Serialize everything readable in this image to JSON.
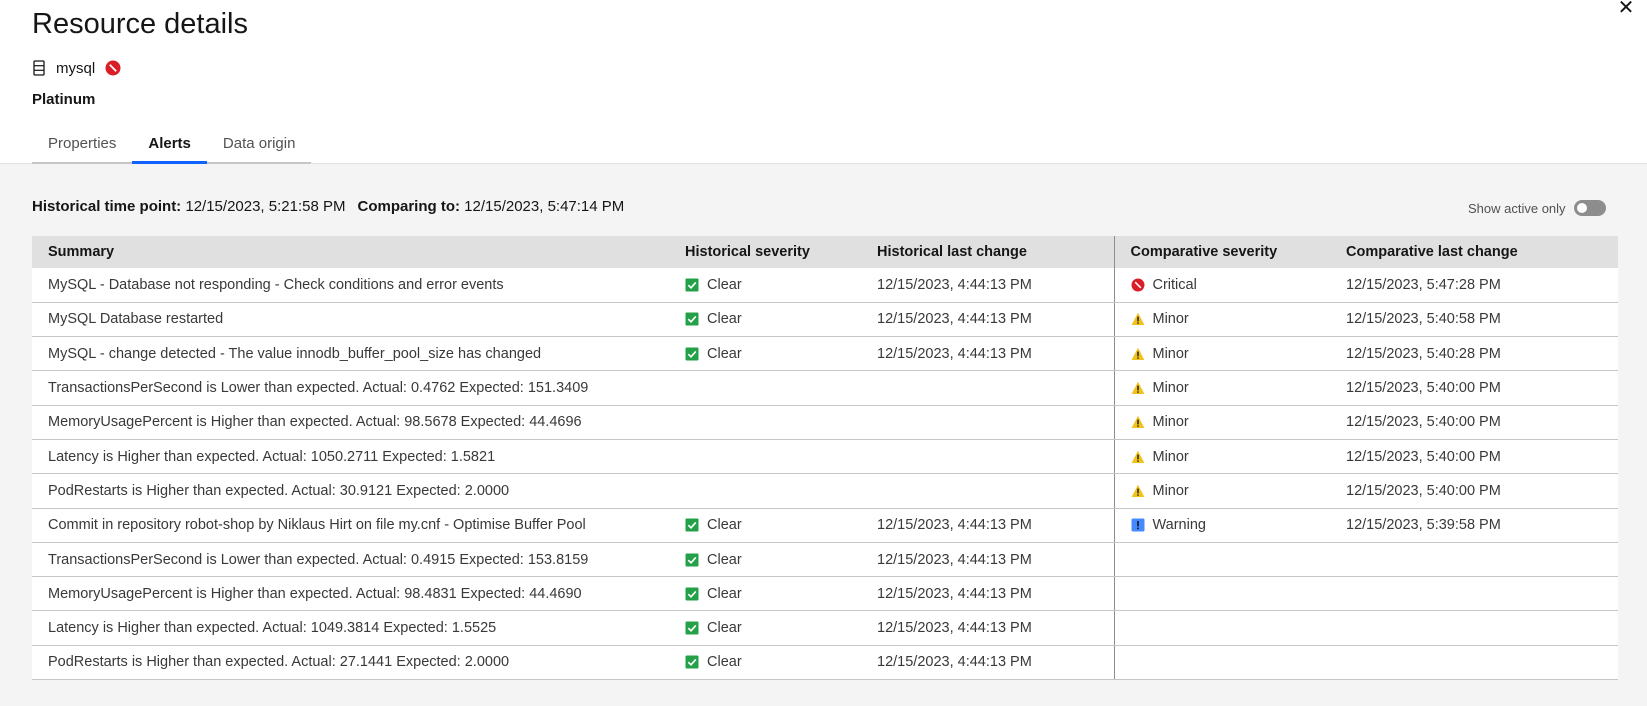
{
  "header": {
    "title": "Resource details",
    "resource_name": "mysql",
    "tier": "Platinum"
  },
  "tabs": [
    {
      "label": "Properties",
      "active": false
    },
    {
      "label": "Alerts",
      "active": true
    },
    {
      "label": "Data origin",
      "active": false
    }
  ],
  "timepoints": {
    "historical_label": "Historical time point:",
    "historical_value": "12/15/2023, 5:21:58 PM",
    "comparing_label": "Comparing to:",
    "comparing_value": "12/15/2023, 5:47:14 PM"
  },
  "toggle": {
    "label": "Show active only",
    "on": false
  },
  "table": {
    "columns": [
      "Summary",
      "Historical severity",
      "Historical last change",
      "Comparative severity",
      "Comparative last change"
    ],
    "rows": [
      {
        "summary": "MySQL - Database not responding - Check conditions and error events",
        "hist_sev": "Clear",
        "hist_change": "12/15/2023, 4:44:13 PM",
        "comp_sev": "Critical",
        "comp_change": "12/15/2023, 5:47:28 PM"
      },
      {
        "summary": "MySQL Database restarted",
        "hist_sev": "Clear",
        "hist_change": "12/15/2023, 4:44:13 PM",
        "comp_sev": "Minor",
        "comp_change": "12/15/2023, 5:40:58 PM"
      },
      {
        "summary": "MySQL - change detected - The value innodb_buffer_pool_size has changed",
        "hist_sev": "Clear",
        "hist_change": "12/15/2023, 4:44:13 PM",
        "comp_sev": "Minor",
        "comp_change": "12/15/2023, 5:40:28 PM"
      },
      {
        "summary": "TransactionsPerSecond is Lower than expected. Actual: 0.4762 Expected: 151.3409",
        "hist_sev": "",
        "hist_change": "",
        "comp_sev": "Minor",
        "comp_change": "12/15/2023, 5:40:00 PM"
      },
      {
        "summary": "MemoryUsagePercent is Higher than expected. Actual: 98.5678 Expected: 44.4696",
        "hist_sev": "",
        "hist_change": "",
        "comp_sev": "Minor",
        "comp_change": "12/15/2023, 5:40:00 PM"
      },
      {
        "summary": "Latency is Higher than expected. Actual: 1050.2711 Expected: 1.5821",
        "hist_sev": "",
        "hist_change": "",
        "comp_sev": "Minor",
        "comp_change": "12/15/2023, 5:40:00 PM"
      },
      {
        "summary": "PodRestarts is Higher than expected. Actual: 30.9121 Expected: 2.0000",
        "hist_sev": "",
        "hist_change": "",
        "comp_sev": "Minor",
        "comp_change": "12/15/2023, 5:40:00 PM"
      },
      {
        "summary": "Commit in repository robot-shop by Niklaus Hirt on file my.cnf - Optimise Buffer Pool",
        "hist_sev": "Clear",
        "hist_change": "12/15/2023, 4:44:13 PM",
        "comp_sev": "Warning",
        "comp_change": "12/15/2023, 5:39:58 PM"
      },
      {
        "summary": "TransactionsPerSecond is Lower than expected. Actual: 0.4915 Expected: 153.8159",
        "hist_sev": "Clear",
        "hist_change": "12/15/2023, 4:44:13 PM",
        "comp_sev": "",
        "comp_change": ""
      },
      {
        "summary": "MemoryUsagePercent is Higher than expected. Actual: 98.4831 Expected: 44.4690",
        "hist_sev": "Clear",
        "hist_change": "12/15/2023, 4:44:13 PM",
        "comp_sev": "",
        "comp_change": ""
      },
      {
        "summary": "Latency is Higher than expected. Actual: 1049.3814 Expected: 1.5525",
        "hist_sev": "Clear",
        "hist_change": "12/15/2023, 4:44:13 PM",
        "comp_sev": "",
        "comp_change": ""
      },
      {
        "summary": "PodRestarts is Higher than expected. Actual: 27.1441 Expected: 2.0000",
        "hist_sev": "Clear",
        "hist_change": "12/15/2023, 4:44:13 PM",
        "comp_sev": "",
        "comp_change": ""
      }
    ]
  },
  "severity_icons": {
    "Clear": {
      "icon": "checkbox-check-icon",
      "color": "#24a148"
    },
    "Critical": {
      "icon": "critical-icon",
      "color": "#da1e28"
    },
    "Minor": {
      "icon": "warning-triangle-icon",
      "color": "#f1c21b"
    },
    "Warning": {
      "icon": "info-square-icon",
      "color": "#4589ff"
    }
  }
}
